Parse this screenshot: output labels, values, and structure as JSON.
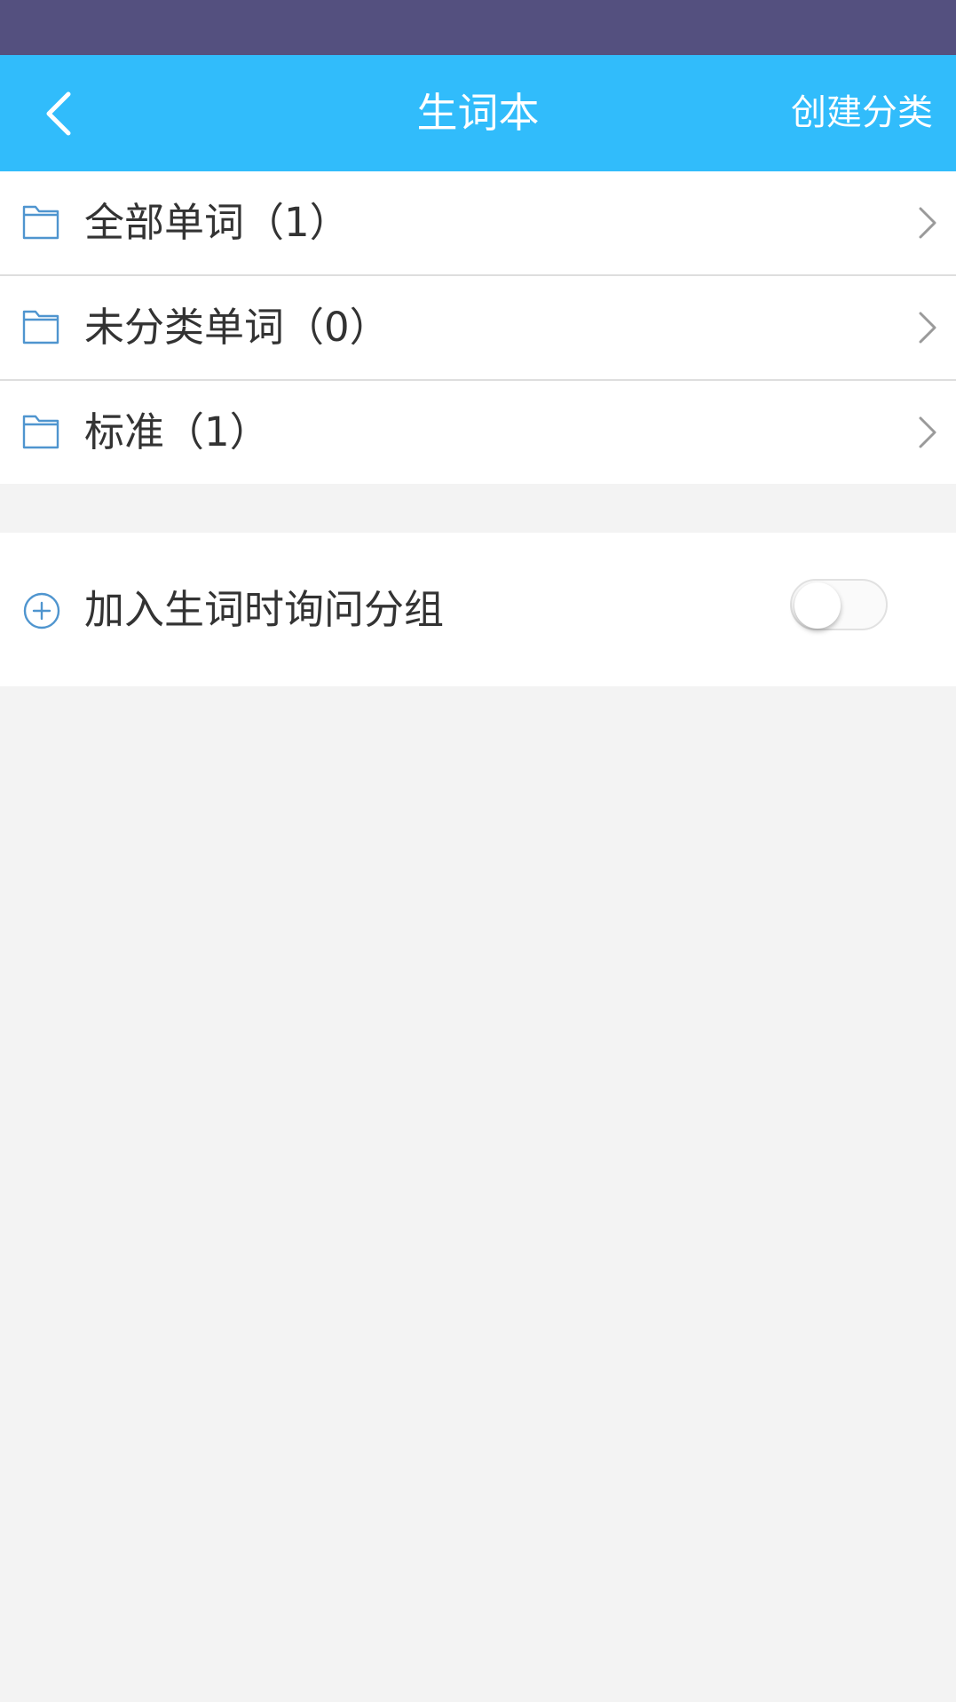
{
  "colors": {
    "status_bar": "#54507f",
    "app_bar": "#31bcfb",
    "icon_accent": "#4f95cf",
    "background": "#f3f3f3"
  },
  "header": {
    "title": "生词本",
    "back_icon": "chevron-left-icon",
    "create_category_label": "创建分类"
  },
  "categories": [
    {
      "label": "全部单词（1）",
      "icon": "folder-icon"
    },
    {
      "label": "未分类单词（0）",
      "icon": "folder-icon"
    },
    {
      "label": "标准（1）",
      "icon": "folder-icon"
    }
  ],
  "settings": {
    "ask_group_label": "加入生词时询问分组",
    "ask_group_icon": "plus-circle-icon",
    "ask_group_enabled": false
  }
}
